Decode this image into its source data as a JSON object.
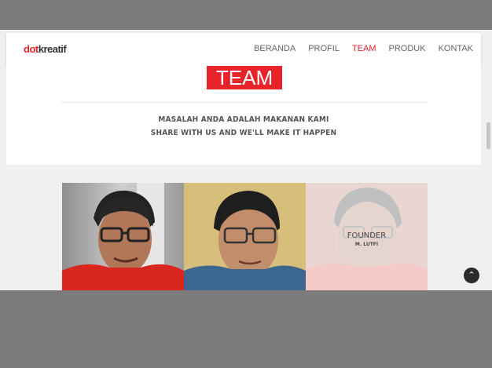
{
  "brand": {
    "prefix": "dot",
    "suffix": "kreatif"
  },
  "nav": [
    "BERANDA",
    "PROFIL",
    "TEAM",
    "PRODUK",
    "KONTAK"
  ],
  "active_nav": "TEAM",
  "section": {
    "title": "TEAM",
    "tagline1": "MASALAH ANDA ADALAH MAKANAN KAMI",
    "tagline2": "SHARE WITH US AND WE'LL MAKE IT HAPPEN"
  },
  "team": {
    "hover_role": "FOUNDER",
    "hover_name": "M. LUTFI"
  },
  "icons": {
    "scroll_top": "chevron-up-icon"
  },
  "colors": {
    "accent": "#e8232a"
  }
}
